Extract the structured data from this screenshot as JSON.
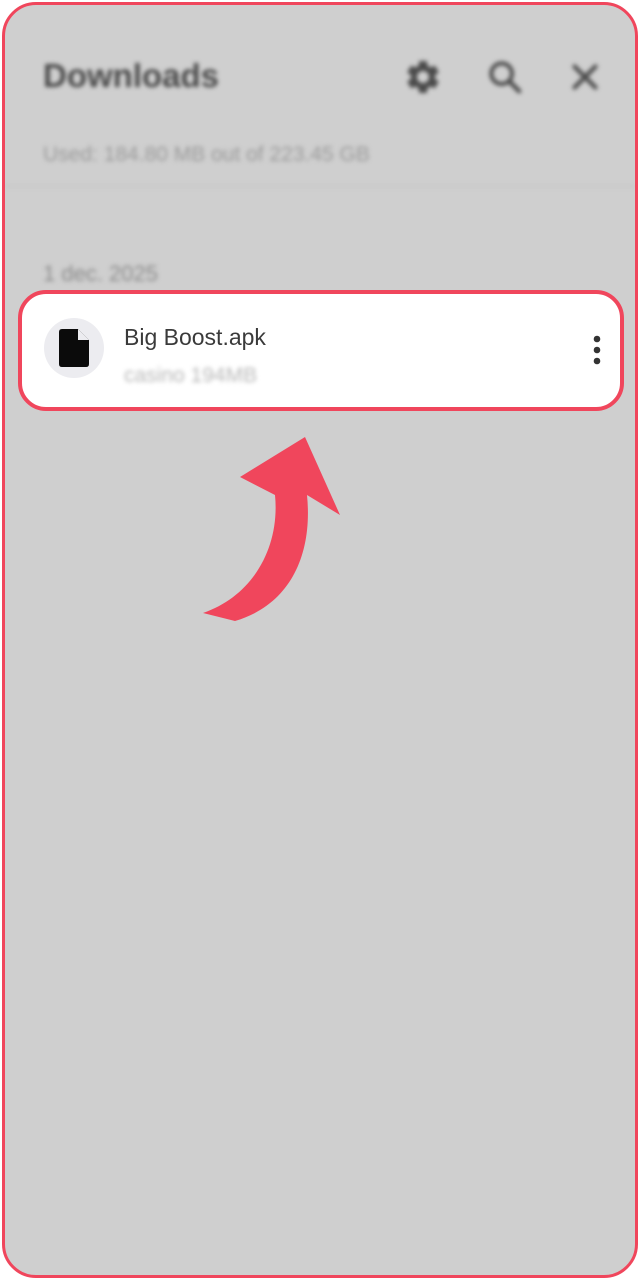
{
  "header": {
    "title": "Downloads",
    "settings_icon": "gear-icon",
    "search_icon": "search-icon",
    "close_icon": "close-icon"
  },
  "storage": {
    "usage_text": "Used: 184.80 MB out of 223.45 GB"
  },
  "section": {
    "date_label": "1 dec. 2025"
  },
  "download_item": {
    "file_icon": "file-icon",
    "name": "Big Boost.apk",
    "meta": "casino 194MB",
    "more_icon": "more-vertical-icon"
  },
  "annotation": {
    "arrow_icon": "curved-arrow-icon",
    "highlight_color": "#f0465c"
  }
}
